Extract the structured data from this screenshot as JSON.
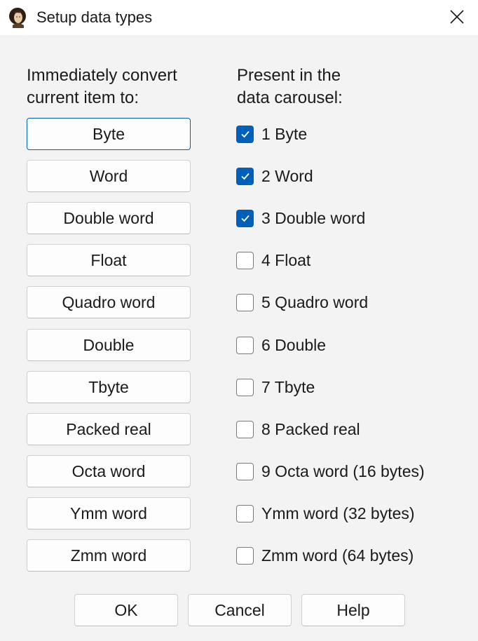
{
  "window": {
    "title": "Setup data types",
    "icon": "portrait-app-icon",
    "close_icon": "close-icon"
  },
  "left_heading_line1": "Immediately convert",
  "left_heading_line2": "current item to:",
  "right_heading_line1": "Present in the",
  "right_heading_line2": "data carousel:",
  "convert_buttons": [
    {
      "label": "Byte",
      "default": true
    },
    {
      "label": "Word"
    },
    {
      "label": "Double word"
    },
    {
      "label": "Float"
    },
    {
      "label": "Quadro word"
    },
    {
      "label": "Double"
    },
    {
      "label": "Tbyte"
    },
    {
      "label": "Packed real"
    },
    {
      "label": "Octa word"
    },
    {
      "label": "Ymm word"
    },
    {
      "label": "Zmm word"
    }
  ],
  "carousel_items": [
    {
      "label": "1 Byte",
      "checked": true
    },
    {
      "label": "2 Word",
      "checked": true
    },
    {
      "label": "3 Double word",
      "checked": true
    },
    {
      "label": "4 Float",
      "checked": false
    },
    {
      "label": "5 Quadro word",
      "checked": false
    },
    {
      "label": "6 Double",
      "checked": false
    },
    {
      "label": "7 Tbyte",
      "checked": false
    },
    {
      "label": "8 Packed real",
      "checked": false
    },
    {
      "label": "9 Octa word (16 bytes)",
      "checked": false
    },
    {
      "label": "Ymm word (32 bytes)",
      "checked": false
    },
    {
      "label": "Zmm word (64 bytes)",
      "checked": false
    }
  ],
  "footer": {
    "ok_label": "OK",
    "cancel_label": "Cancel",
    "help_label": "Help"
  },
  "colors": {
    "accent": "#005fb8",
    "background": "#f3f3f3",
    "titlebar": "#ffffff"
  }
}
